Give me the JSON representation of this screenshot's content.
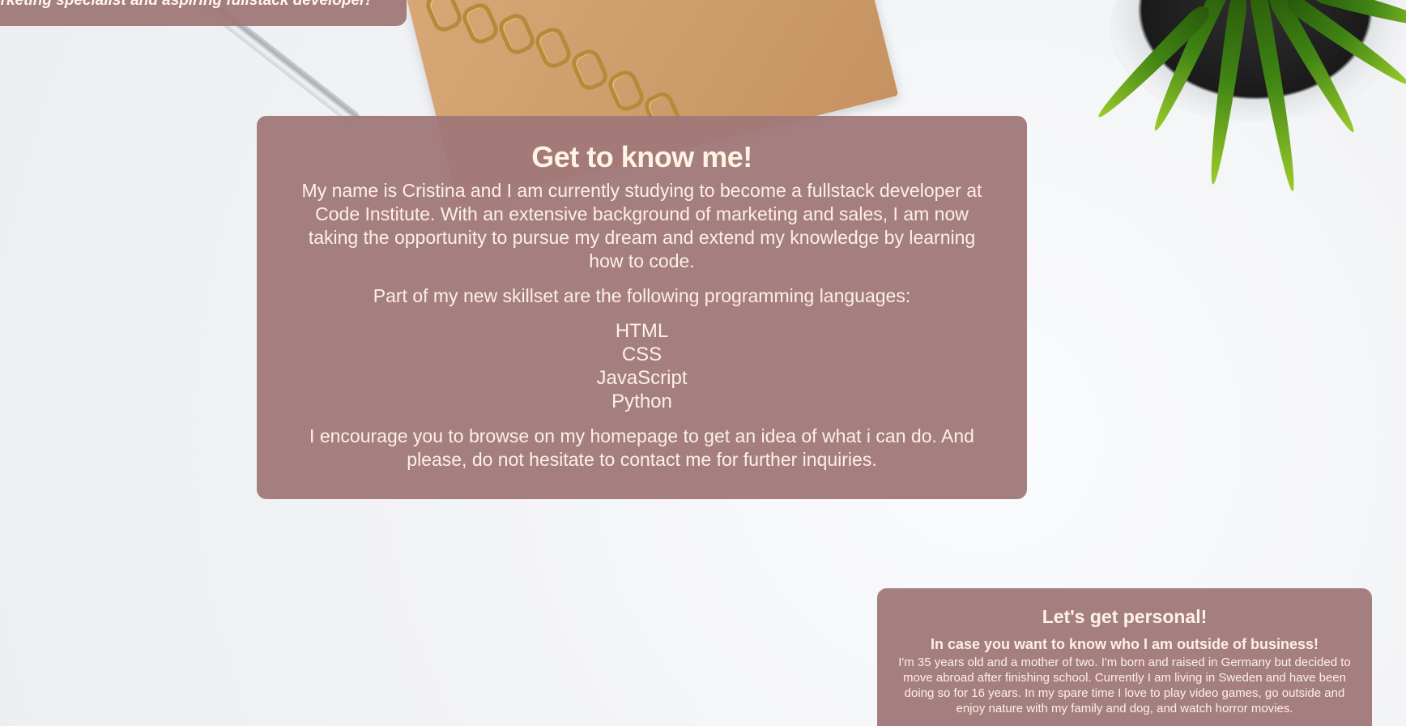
{
  "header": {
    "tagline": "arketing specialist and aspiring fullstack developer!"
  },
  "about": {
    "title": "Get to know me!",
    "intro": "My name is Cristina and I am currently studying to become a fullstack developer at Code Institute. With an extensive background of marketing and sales, I am now taking the opportunity to pursue my dream and extend my knowledge by learning how to code.",
    "skills_intro": "Part of my new skillset are the following programming languages:",
    "skills": [
      "HTML",
      "CSS",
      "JavaScript",
      "Python"
    ],
    "outro": "I encourage you to browse on my homepage to get an idea of what i can do. And please, do not hesitate to contact me for further inquiries."
  },
  "personal": {
    "title": "Let's get personal!",
    "subtitle": "In case you want to know who I am outside of business!",
    "body": "I'm 35 years old and a mother of two. I'm born and raised in Germany but decided to move abroad after finishing school. Currently I am living in Sweden and have been doing so for 16 years. In my spare time I love to play video games, go outside and enjoy nature with my family and dog, and watch horror movies."
  },
  "colors": {
    "card_bg": "#a07878",
    "card_text": "#fdf0e4",
    "page_bg": "#f5f6f8"
  }
}
